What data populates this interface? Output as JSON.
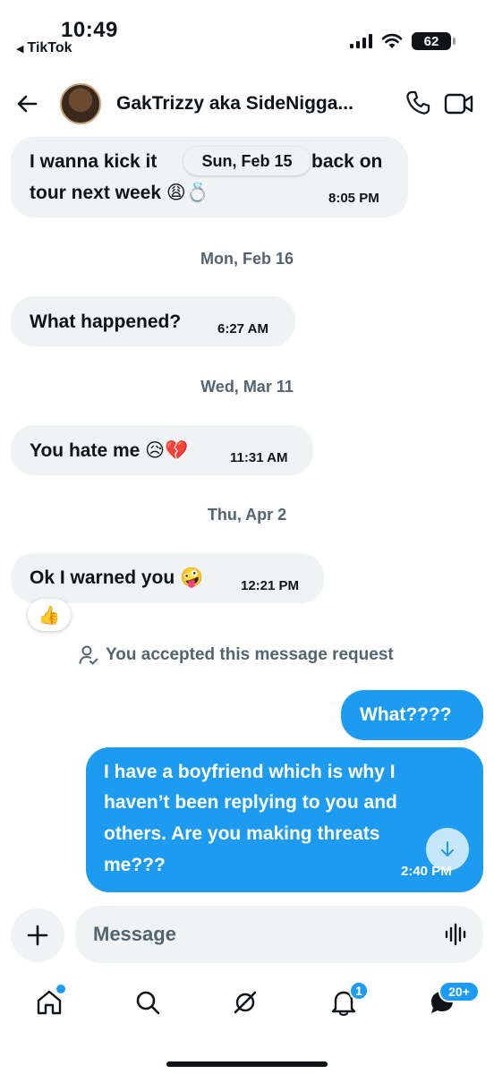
{
  "status_bar": {
    "time": "10:49",
    "back_app": "TikTok",
    "battery": "62"
  },
  "header": {
    "contact_name": "GakTrizzy aka SideNigga...",
    "back_icon": "arrow-left-icon",
    "call_icon": "phone-icon",
    "video_icon": "video-camera-icon"
  },
  "messages": [
    {
      "line1": "I wanna kick it",
      "line1_tail": "back on",
      "line2": "tour next week 😩💍",
      "time": "8:05 PM"
    },
    {
      "text": "What happened?",
      "time": "6:27 AM"
    },
    {
      "text": "You hate me 😥💔",
      "time": "11:31 AM"
    },
    {
      "text": "Ok I warned you 🤪",
      "time": "12:21 PM",
      "reaction": "👍"
    },
    {
      "text": "What????"
    },
    {
      "lines": [
        "I have a boyfriend which is why I",
        "haven’t been replying to you and",
        "others. Are you making threats",
        "me???"
      ],
      "time": "2:40 PM"
    }
  ],
  "date_pill": "Sun, Feb 15",
  "date_separators": [
    "Mon, Feb 16",
    "Wed, Mar 11",
    "Thu, Apr 2"
  ],
  "request_notice": "You accepted this message request",
  "composer": {
    "placeholder": "Message"
  },
  "nav": {
    "notifications_badge": "1",
    "messages_badge": "20+"
  },
  "colors": {
    "accent": "#1d9bf0",
    "incoming_bubble": "#eff3f4",
    "muted_text": "#536471"
  }
}
